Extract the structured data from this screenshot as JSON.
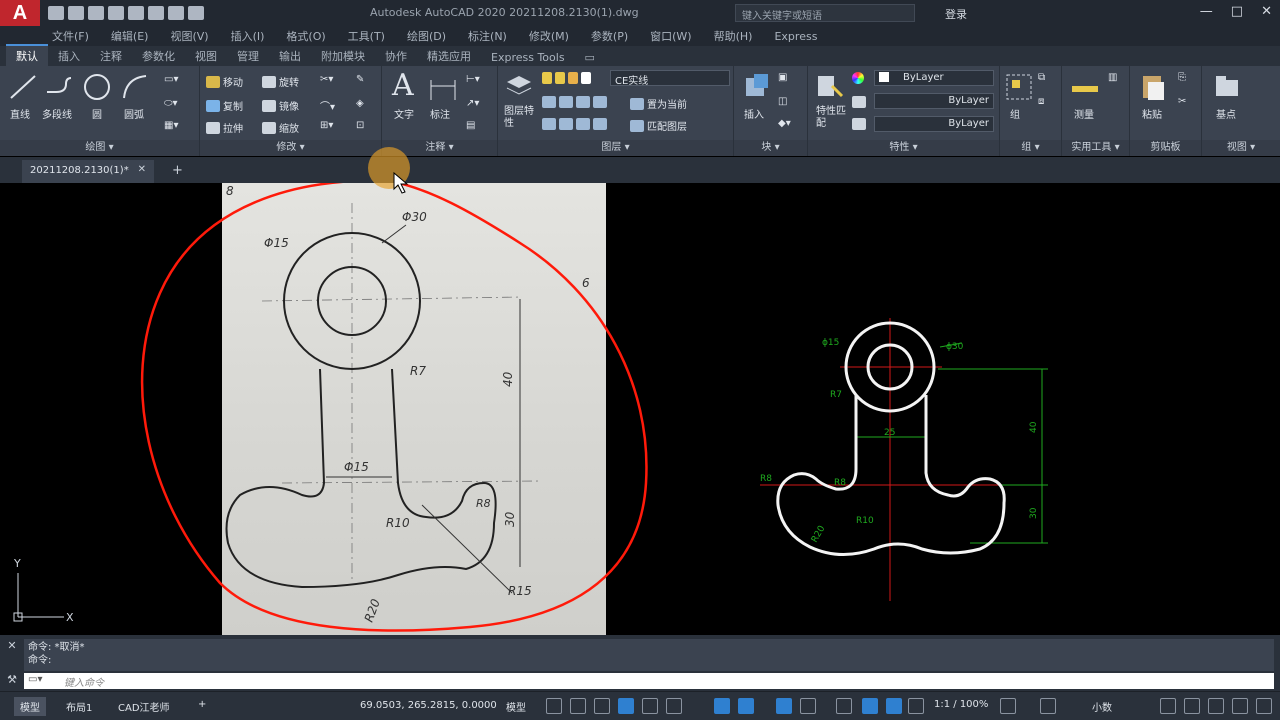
{
  "titlebar": {
    "logo": "A",
    "title": "Autodesk AutoCAD 2020    20211208.2130(1).dwg",
    "search_placeholder": "键入关键字或短语",
    "login": "登录",
    "window_controls": [
      "—",
      "□",
      "✕"
    ]
  },
  "menubar": [
    "文件(F)",
    "编辑(E)",
    "视图(V)",
    "插入(I)",
    "格式(O)",
    "工具(T)",
    "绘图(D)",
    "标注(N)",
    "修改(M)",
    "参数(P)",
    "窗口(W)",
    "帮助(H)",
    "Express"
  ],
  "ribbon_tabs": [
    "默认",
    "插入",
    "注释",
    "参数化",
    "视图",
    "管理",
    "输出",
    "附加模块",
    "协作",
    "精选应用",
    "Express Tools"
  ],
  "ribbon": {
    "draw": {
      "title": "绘图 ▾",
      "line": "直线",
      "polyline": "多段线",
      "circle": "圆",
      "arc": "圆弧"
    },
    "modify": {
      "title": "修改 ▾",
      "move": "移动",
      "rotate": "旋转",
      "copy": "复制",
      "mirror": "镜像",
      "stretch": "拉伸",
      "scale": "缩放"
    },
    "annotation": {
      "title": "注释 ▾",
      "text": "文字",
      "dimension": "标注"
    },
    "layers": {
      "title": "图层 ▾",
      "layer_properties": "图层特性",
      "current_layer": "CE实线",
      "make_current": "置为当前",
      "match_layer": "匹配图层"
    },
    "block": {
      "title": "块 ▾",
      "insert": "插入"
    },
    "properties": {
      "title": "特性 ▾",
      "match": "特性匹配",
      "color": "ByLayer",
      "linetype": "ByLayer",
      "lineweight": "ByLayer"
    },
    "groups": {
      "title": "组 ▾",
      "group": "组"
    },
    "utilities": {
      "title": "实用工具 ▾",
      "measure": "测量"
    },
    "clipboard": {
      "title": "剪贴板",
      "paste": "粘贴"
    },
    "view": {
      "title": "视图 ▾",
      "base": "基点"
    }
  },
  "doc_tab": {
    "name": "20211208.2130(1)*",
    "close": "✕",
    "new": "+"
  },
  "sketch_labels": {
    "phi30": "Φ30",
    "phi15_top": "Φ15",
    "phi15_mid": "Φ15",
    "r7": "R7",
    "dim40": "40",
    "dim30": "30",
    "r10": "R10",
    "r8": "R8",
    "r15": "R15",
    "r20": "R20",
    "corner": "8",
    "side": "6"
  },
  "cad_labels": {
    "phi15": "ϕ15",
    "phi30": "ϕ30",
    "r7": "R7",
    "d25": "25",
    "d40": "40",
    "r8a": "R8",
    "r8b": "R8",
    "r10": "R10",
    "r20": "R20",
    "d30": "30"
  },
  "ucs": {
    "y": "Y",
    "x": "X"
  },
  "command": {
    "history": [
      "命令: *取消*",
      "命令:"
    ],
    "input_placeholder": "键入命令"
  },
  "status": {
    "tabs": [
      "模型",
      "布局1",
      "CAD江老师"
    ],
    "add": "+",
    "coords": "69.0503, 265.2815, 0.0000",
    "mode": "模型",
    "scale": "1:1 / 100%",
    "units": "小数"
  },
  "colors": {
    "accent": "#2f80d0",
    "sketch_circle": "#ff1a0a",
    "cad_dim": "#1faa1f",
    "cad_center": "#d21919",
    "cursor": "#e6a028"
  }
}
